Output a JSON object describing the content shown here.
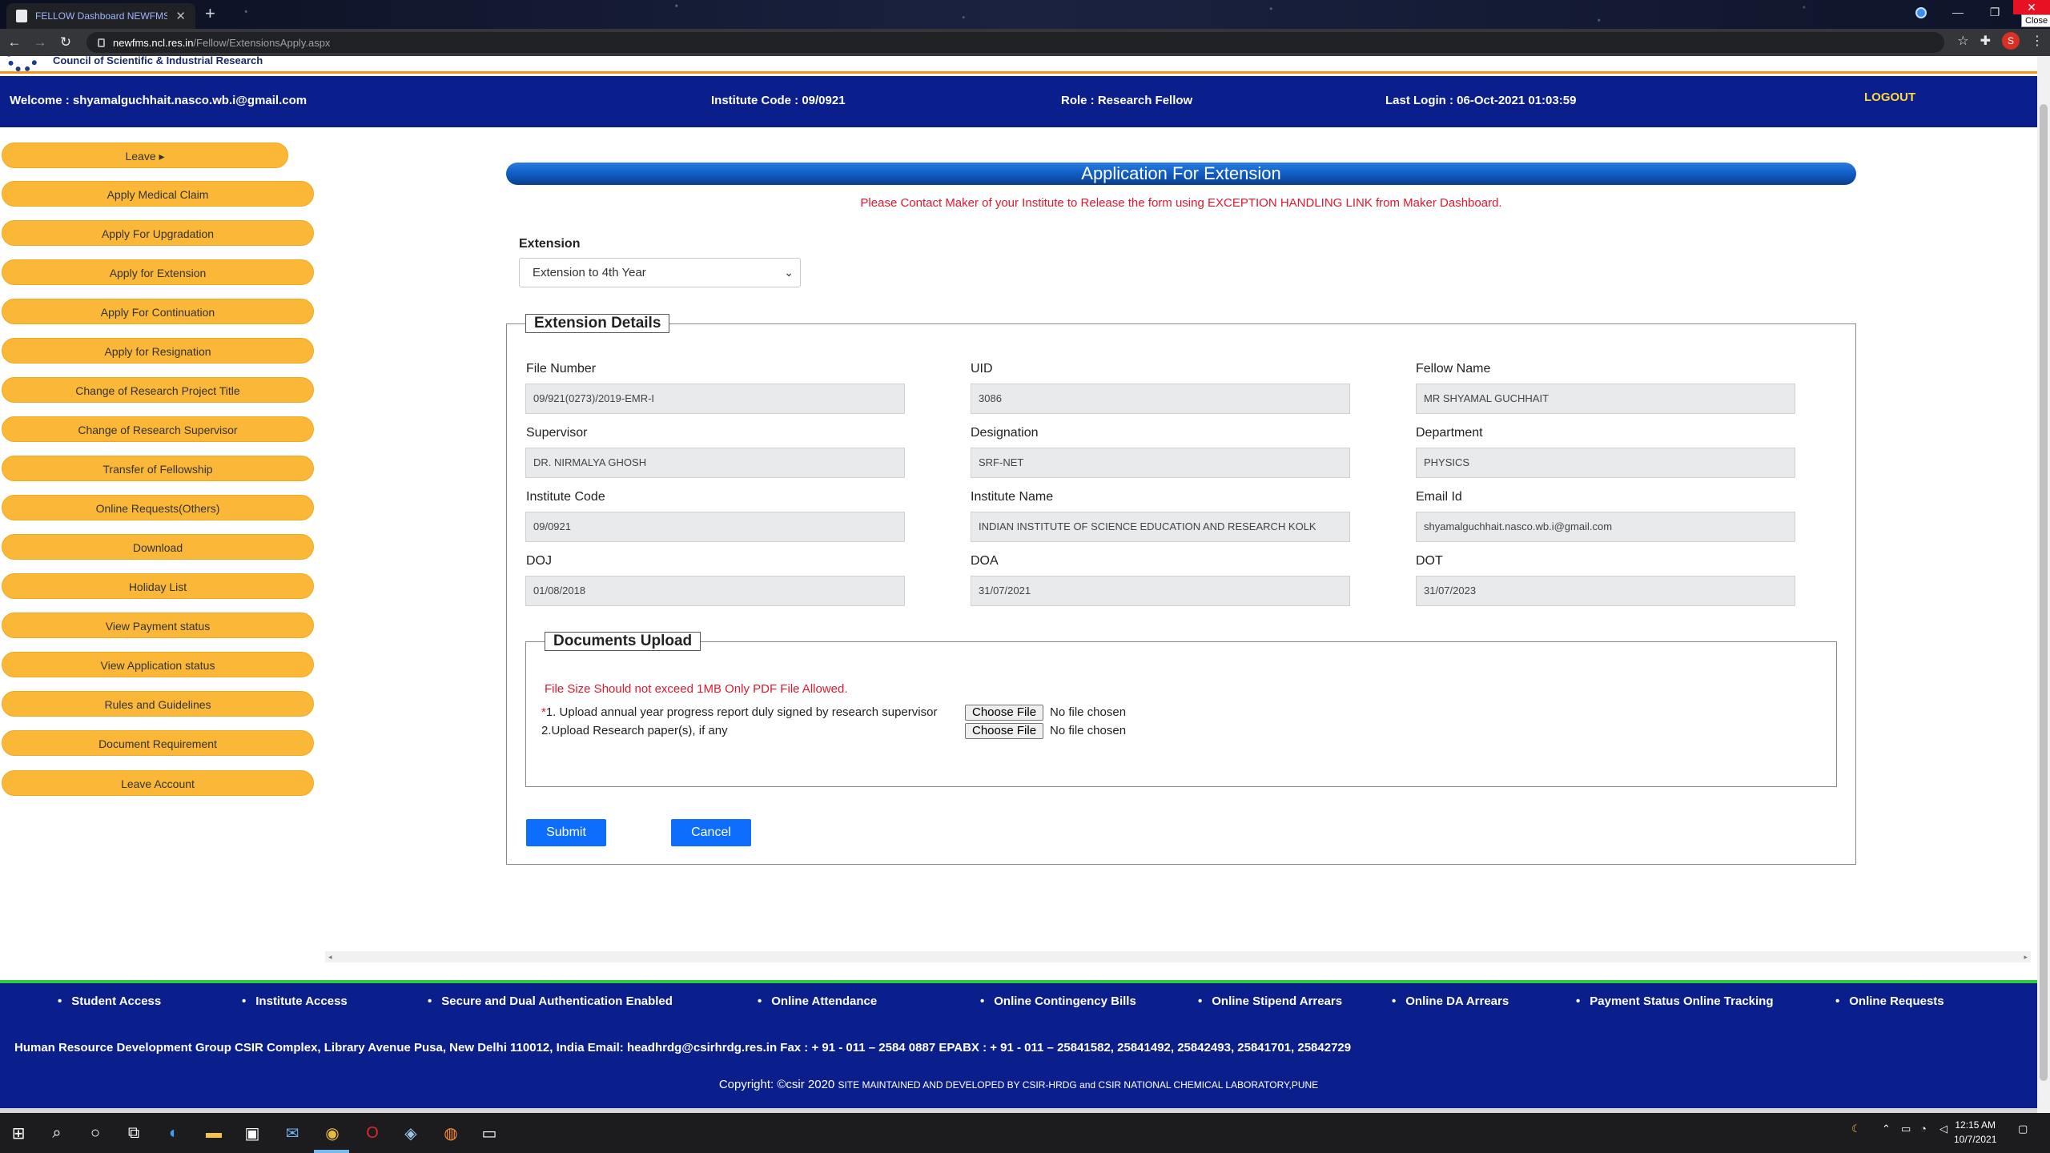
{
  "browser": {
    "tab_title": "FELLOW Dashboard NEWFMS",
    "tab_close": "✕",
    "new_tab": "+",
    "url_host": "newfms.ncl.res.in",
    "url_path": "/Fellow/ExtensionsApply.aspx",
    "close_tooltip": "Close",
    "profile_initial": "S",
    "icons": [
      "back-arrow-icon",
      "forward-arrow-icon",
      "reload-icon",
      "lock-icon",
      "star-icon",
      "puzzle-icon",
      "menu-dots-icon"
    ]
  },
  "header": {
    "org_name": "Council of Scientific & Industrial Research",
    "welcome": "Welcome : shyamalguchhait.nasco.wb.i@gmail.com",
    "institute_code": "Institute Code : 09/0921",
    "role": "Role : Research Fellow",
    "last_login": "Last Login : 06-Oct-2021 01:03:59",
    "logout": "LOGOUT"
  },
  "sidebar": {
    "items": [
      "Leave ▸",
      "Apply Medical Claim",
      "Apply For Upgradation",
      "Apply for Extension",
      "Apply For Continuation",
      "Apply for Resignation",
      "Change of Research Project Title",
      "Change of Research Supervisor",
      "Transfer of Fellowship",
      "Online Requests(Others)",
      "Download",
      "Holiday List",
      "View Payment status",
      "View Application status",
      "Rules and Guidelines",
      "Document Requirement",
      "Leave Account"
    ]
  },
  "main": {
    "title": "Application For Extension",
    "notice": "Please Contact Maker of your Institute to Release the form using EXCEPTION HANDLING LINK from Maker Dashboard.",
    "extension_label": "Extension",
    "extension_selected": "Extension to 4th Year",
    "details_legend": "Extension Details",
    "fields": {
      "file_number": {
        "label": "File Number",
        "value": "09/921(0273)/2019-EMR-I"
      },
      "uid": {
        "label": "UID",
        "value": "3086"
      },
      "fellow_name": {
        "label": "Fellow Name",
        "value": "MR SHYAMAL GUCHHAIT"
      },
      "supervisor": {
        "label": "Supervisor",
        "value": "DR. NIRMALYA GHOSH"
      },
      "designation": {
        "label": "Designation",
        "value": "SRF-NET"
      },
      "department": {
        "label": "Department",
        "value": "PHYSICS"
      },
      "institute_code": {
        "label": "Institute Code",
        "value": "09/0921"
      },
      "institute_name": {
        "label": "Institute Name",
        "value": "INDIAN INSTITUTE OF SCIENCE EDUCATION AND RESEARCH KOLK"
      },
      "email": {
        "label": "Email Id",
        "value": "shyamalguchhait.nasco.wb.i@gmail.com"
      },
      "doj": {
        "label": "DOJ",
        "value": "01/08/2018"
      },
      "doa": {
        "label": "DOA",
        "value": "31/07/2021"
      },
      "dot": {
        "label": "DOT",
        "value": "31/07/2023"
      }
    },
    "documents_legend": "Documents Upload",
    "file_warning": "File Size Should not exceed 1MB Only PDF File Allowed.",
    "upload1_star": "*",
    "upload1_label": "1. Upload annual year progress report duly signed by research supervisor",
    "upload2_label": "2.Upload Research paper(s), if any",
    "choose_file": "Choose File",
    "no_file": "No file chosen",
    "submit": "Submit",
    "cancel": "Cancel"
  },
  "footer": {
    "links": [
      "Student Access",
      "Institute Access",
      "Secure and Dual Authentication Enabled",
      "Online Attendance",
      "Online Contingency Bills",
      "Online Stipend Arrears",
      "Online DA Arrears",
      "Payment Status Online Tracking",
      "Online Requests"
    ],
    "address": "Human Resource Development Group CSIR Complex, Library Avenue Pusa, New Delhi 110012, India Email: headhrdg@csirhrdg.res.in Fax : + 91 - 011 – 2584 0887 EPABX : + 91 - 011 – 25841582, 25841492, 25842493, 25841701, 25842729",
    "copyright": "Copyright: ©csir 2020",
    "maintained": "SITE MAINTAINED AND DEVELOPED BY CSIR-HRDG and CSIR NATIONAL CHEMICAL LABORATORY,PUNE"
  },
  "taskbar": {
    "time": "12:15 AM",
    "date": "10/7/2021"
  }
}
